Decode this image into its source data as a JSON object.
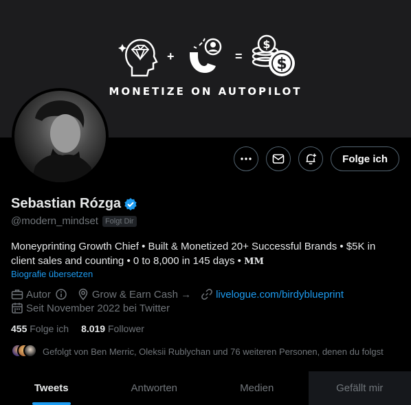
{
  "banner": {
    "tagline": "MONETIZE ON AUTOPILOT",
    "plus": "+",
    "equals": "="
  },
  "profile": {
    "display_name": "Sebastian Rózga",
    "handle": "@modern_mindset",
    "follows_you": "Folgt Dir",
    "verified_color": "#1d9bf0"
  },
  "actions": {
    "more_icon": "more-icon",
    "message_icon": "mail-icon",
    "notify_icon": "bell-plus-icon",
    "follow_label": "Folge ich"
  },
  "bio": {
    "text": "Moneyprinting Growth Chief • Built & Monetized 20+ Successful Brands • $5K in client sales and counting • 0 to 8,000 in 145 days •",
    "mark": "MM",
    "translate_label": "Biografie übersetzen"
  },
  "meta": {
    "category": "Autor",
    "location": "Grow & Earn Cash →",
    "link": "livelogue.com/birdyblueprint",
    "joined": "Seit November 2022 bei Twitter"
  },
  "stats": {
    "following_count": "455",
    "following_label": "Folge ich",
    "followers_count": "8.019",
    "followers_label": "Follower"
  },
  "followed_by": {
    "text": "Gefolgt von Ben Merric, Oleksii Rublychan und 76 weiteren Personen, denen du folgst"
  },
  "tabs": [
    {
      "label": "Tweets"
    },
    {
      "label": "Antworten"
    },
    {
      "label": "Medien"
    },
    {
      "label": "Gefällt mir"
    }
  ]
}
